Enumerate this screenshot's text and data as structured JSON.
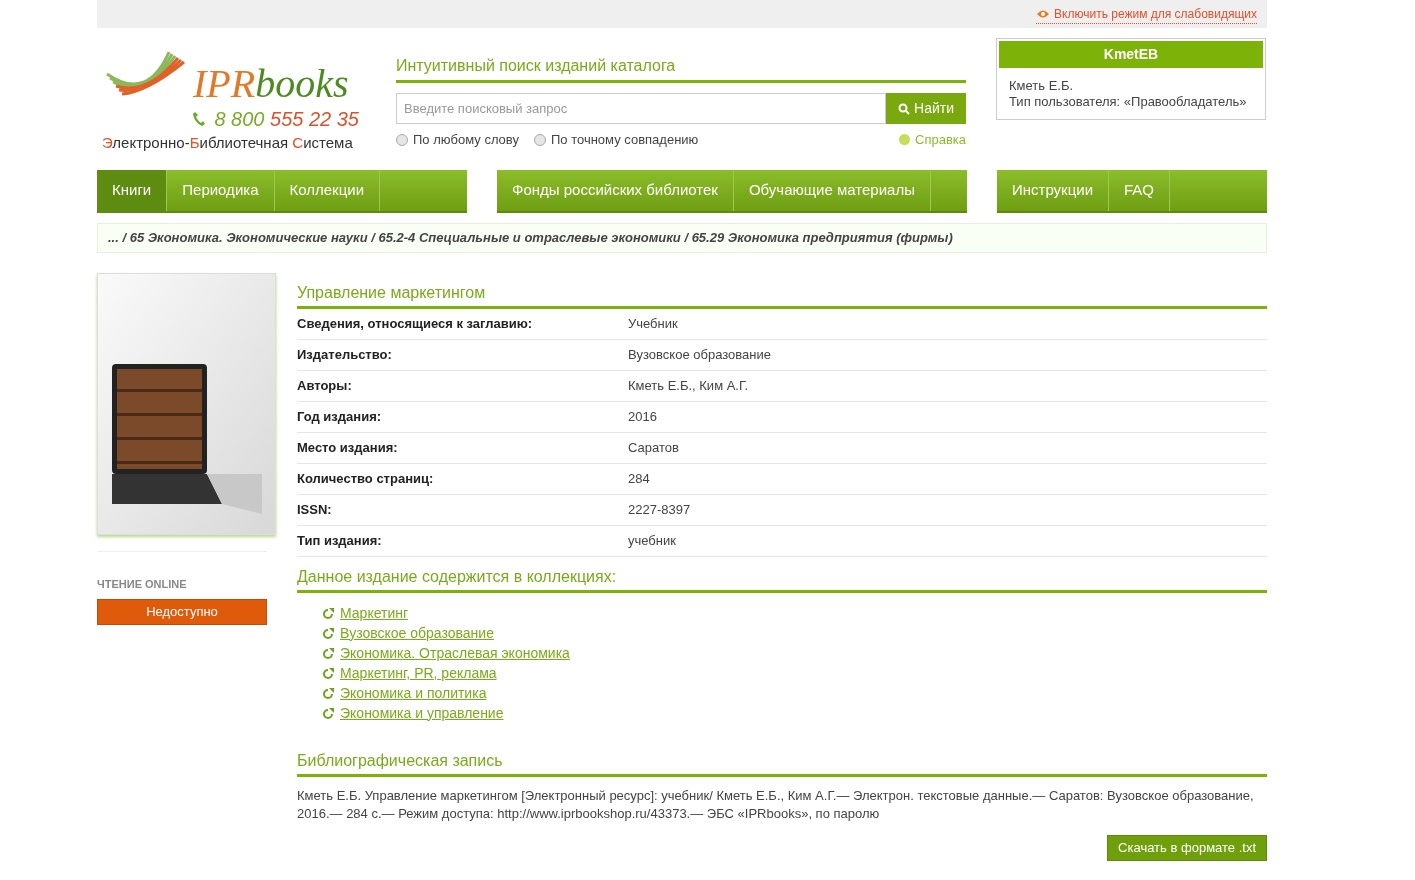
{
  "topbar": {
    "accessibility_link": "Включить режим для слабовидящих"
  },
  "logo": {
    "brand_first": "IPR",
    "brand_second": "books",
    "phone_first": "8 800",
    "phone_second": "555 22 35",
    "tagline": "Электронно-Библиотечная Система"
  },
  "search": {
    "title": "Интуитивный поиск изданий каталога",
    "placeholder": "Введите поисковый запрос",
    "button": "Найти",
    "options": [
      {
        "label": "По любому слову",
        "selected": false
      },
      {
        "label": "По точному совпадению",
        "selected": false
      }
    ],
    "help": "Справка"
  },
  "user": {
    "login": "KmetEB",
    "name": "Кметь Е.Б.",
    "type": "Тип пользователя: «Правообладатель»"
  },
  "nav": [
    [
      {
        "label": "Книги",
        "selected": true
      },
      {
        "label": "Периодика",
        "selected": false
      },
      {
        "label": "Коллекции",
        "selected": false
      }
    ],
    [
      {
        "label": "Фонды российских библиотек",
        "selected": false
      },
      {
        "label": "Обучающие материалы",
        "selected": false
      }
    ],
    [
      {
        "label": "Инструкции",
        "selected": false
      },
      {
        "label": "FAQ",
        "selected": false
      }
    ]
  ],
  "breadcrumb": "... / 65 Экономика. Экономические науки / 65.2-4 Специальные и отраслевые экономики / 65.29 Экономика предприятия (фирмы)",
  "sidebar": {
    "reading_label": "ЧТЕНИЕ ONLINE",
    "reading_button": "Недоступно"
  },
  "book": {
    "title": "Управление маркетингом",
    "details": [
      {
        "label": "Сведения, относящиеся к заглавию:",
        "value": "Учебник"
      },
      {
        "label": "Издательство:",
        "value": "Вузовское образование"
      },
      {
        "label": "Авторы:",
        "value": "Кметь Е.Б., Ким А.Г."
      },
      {
        "label": "Год издания:",
        "value": "2016"
      },
      {
        "label": "Место издания:",
        "value": "Саратов"
      },
      {
        "label": "Количество страниц:",
        "value": "284"
      },
      {
        "label": "ISSN:",
        "value": "2227-8397"
      },
      {
        "label": "Тип издания:",
        "value": "учебник"
      }
    ]
  },
  "collections": {
    "title": "Данное издание содержится в коллекциях:",
    "items": [
      "Маркетинг",
      "Вузовское образование",
      "Экономика. Отраслевая экономика",
      "Маркетинг, PR, реклама",
      "Экономика и политика",
      "Экономика и управление"
    ]
  },
  "bibliography": {
    "title": "Библиографическая запись",
    "text": "Кметь Е.Б. Управление маркетингом [Электронный ресурс]: учебник/ Кметь Е.Б., Ким А.Г.— Электрон. текстовые данные.— Саратов: Вузовское образование, 2016.— 284 c.— Режим доступа: http://www.iprbookshop.ru/43373.— ЭБС «IPRbooks», по паролю",
    "download": "Скачать в формате .txt"
  }
}
